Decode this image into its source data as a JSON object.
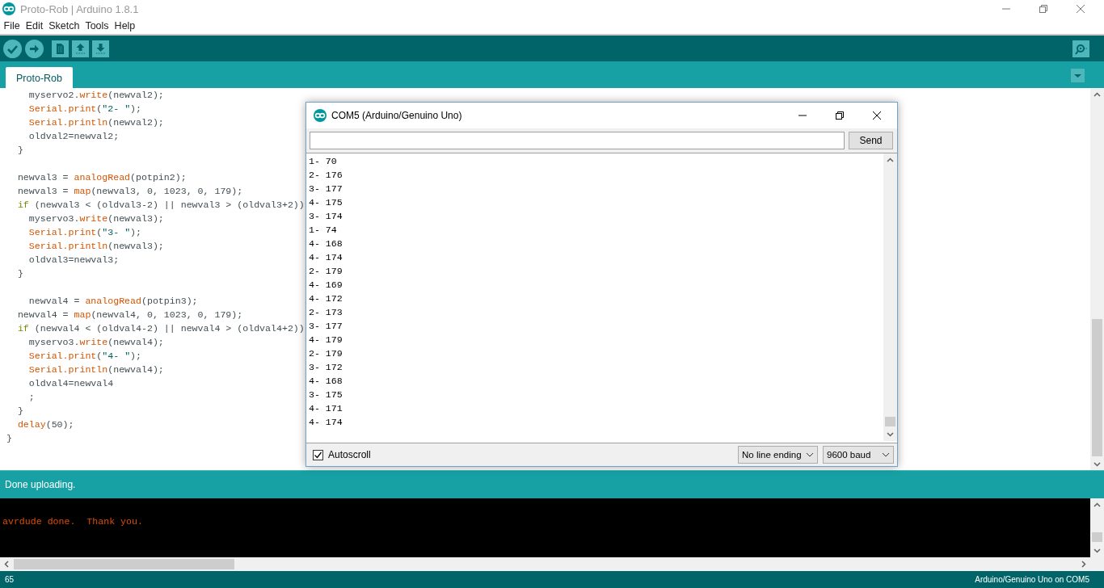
{
  "window": {
    "title": "Proto-Rob | Arduino 1.8.1"
  },
  "menu": [
    "File",
    "Edit",
    "Sketch",
    "Tools",
    "Help"
  ],
  "tabs": [
    {
      "label": "Proto-Rob",
      "selected": true
    }
  ],
  "editor": {
    "lines": [
      {
        "kind": "code",
        "segments": [
          {
            "t": "    myservo2.",
            "kind": "plain"
          },
          {
            "t": "write",
            "kind": "fn"
          },
          {
            "t": "(newval2);",
            "kind": "plain"
          }
        ]
      },
      {
        "kind": "code",
        "segments": [
          {
            "t": "    Serial.print",
            "kind": "fn"
          },
          {
            "t": "(",
            "kind": "plain"
          },
          {
            "t": "\"2- \"",
            "kind": "str"
          },
          {
            "t": ");",
            "kind": "plain"
          }
        ]
      },
      {
        "kind": "code",
        "segments": [
          {
            "t": "    Serial.println",
            "kind": "fn"
          },
          {
            "t": "(newval2);",
            "kind": "plain"
          }
        ]
      },
      {
        "kind": "code",
        "segments": [
          {
            "t": "    oldval2=newval2;",
            "kind": "plain"
          }
        ]
      },
      {
        "kind": "code",
        "segments": [
          {
            "t": "  }",
            "kind": "plain"
          }
        ]
      },
      {
        "kind": "blank"
      },
      {
        "kind": "code",
        "segments": [
          {
            "t": "  newval3 = ",
            "kind": "plain"
          },
          {
            "t": "analogRead",
            "kind": "fn"
          },
          {
            "t": "(potpin2);",
            "kind": "plain"
          }
        ]
      },
      {
        "kind": "code",
        "segments": [
          {
            "t": "  newval3 = ",
            "kind": "plain"
          },
          {
            "t": "map",
            "kind": "fn"
          },
          {
            "t": "(newval3, 0, 1023, 0, 179);",
            "kind": "plain"
          }
        ]
      },
      {
        "kind": "code",
        "segments": [
          {
            "t": "  if",
            "kind": "kw"
          },
          {
            "t": " (newval3 < (oldval3-2) || newval3 > (oldval3+2))",
            "kind": "plain"
          }
        ]
      },
      {
        "kind": "code",
        "segments": [
          {
            "t": "    myservo3.",
            "kind": "plain"
          },
          {
            "t": "write",
            "kind": "fn"
          },
          {
            "t": "(newval3);",
            "kind": "plain"
          }
        ]
      },
      {
        "kind": "code",
        "segments": [
          {
            "t": "    Serial.print",
            "kind": "fn"
          },
          {
            "t": "(",
            "kind": "plain"
          },
          {
            "t": "\"3- \"",
            "kind": "str"
          },
          {
            "t": ");",
            "kind": "plain"
          }
        ]
      },
      {
        "kind": "code",
        "segments": [
          {
            "t": "    Serial.println",
            "kind": "fn"
          },
          {
            "t": "(newval3);",
            "kind": "plain"
          }
        ]
      },
      {
        "kind": "code",
        "segments": [
          {
            "t": "    oldval3=newval3;",
            "kind": "plain"
          }
        ]
      },
      {
        "kind": "code",
        "segments": [
          {
            "t": "  }",
            "kind": "plain"
          }
        ]
      },
      {
        "kind": "blank"
      },
      {
        "kind": "code",
        "segments": [
          {
            "t": "    newval4 = ",
            "kind": "plain"
          },
          {
            "t": "analogRead",
            "kind": "fn"
          },
          {
            "t": "(potpin3);",
            "kind": "plain"
          }
        ]
      },
      {
        "kind": "code",
        "segments": [
          {
            "t": "  newval4 = ",
            "kind": "plain"
          },
          {
            "t": "map",
            "kind": "fn"
          },
          {
            "t": "(newval4, 0, 1023, 0, 179);",
            "kind": "plain"
          }
        ]
      },
      {
        "kind": "code",
        "segments": [
          {
            "t": "  if",
            "kind": "kw"
          },
          {
            "t": " (newval4 < (oldval4-2) || newval4 > (oldval4+2))",
            "kind": "plain"
          }
        ]
      },
      {
        "kind": "code",
        "segments": [
          {
            "t": "    myservo3.",
            "kind": "plain"
          },
          {
            "t": "write",
            "kind": "fn"
          },
          {
            "t": "(newval4);",
            "kind": "plain"
          }
        ]
      },
      {
        "kind": "code",
        "segments": [
          {
            "t": "    Serial.print",
            "kind": "fn"
          },
          {
            "t": "(",
            "kind": "plain"
          },
          {
            "t": "\"4- \"",
            "kind": "str"
          },
          {
            "t": ");",
            "kind": "plain"
          }
        ]
      },
      {
        "kind": "code",
        "segments": [
          {
            "t": "    Serial.println",
            "kind": "fn"
          },
          {
            "t": "(newval4);",
            "kind": "plain"
          }
        ]
      },
      {
        "kind": "code",
        "segments": [
          {
            "t": "    oldval4=newval4",
            "kind": "plain"
          }
        ]
      },
      {
        "kind": "code",
        "segments": [
          {
            "t": "    ;",
            "kind": "plain"
          }
        ]
      },
      {
        "kind": "code",
        "segments": [
          {
            "t": "  }",
            "kind": "plain"
          }
        ]
      },
      {
        "kind": "code",
        "segments": [
          {
            "t": "  delay",
            "kind": "fn"
          },
          {
            "t": "(50);",
            "kind": "plain"
          }
        ]
      },
      {
        "kind": "code",
        "segments": [
          {
            "t": "}",
            "kind": "plain"
          }
        ]
      }
    ]
  },
  "status_message": "Done uploading.",
  "console": {
    "lines": [
      "avrdude done.  Thank you."
    ]
  },
  "status_bar": {
    "line_number": "65",
    "board": "Arduino/Genuino Uno on COM5"
  },
  "serial_monitor": {
    "title": "COM5 (Arduino/Genuino Uno)",
    "send_button": "Send",
    "output": [
      "1- 70",
      "2- 176",
      "3- 177",
      "4- 175",
      "3- 174",
      "1- 74",
      "4- 168",
      "4- 174",
      "2- 179",
      "4- 169",
      "4- 172",
      "2- 173",
      "3- 177",
      "4- 179",
      "2- 179",
      "3- 172",
      "4- 168",
      "3- 175",
      "4- 171",
      "4- 174"
    ],
    "autoscroll": {
      "label": "Autoscroll",
      "checked": true
    },
    "line_ending": "No line ending",
    "baud": "9600 baud"
  }
}
